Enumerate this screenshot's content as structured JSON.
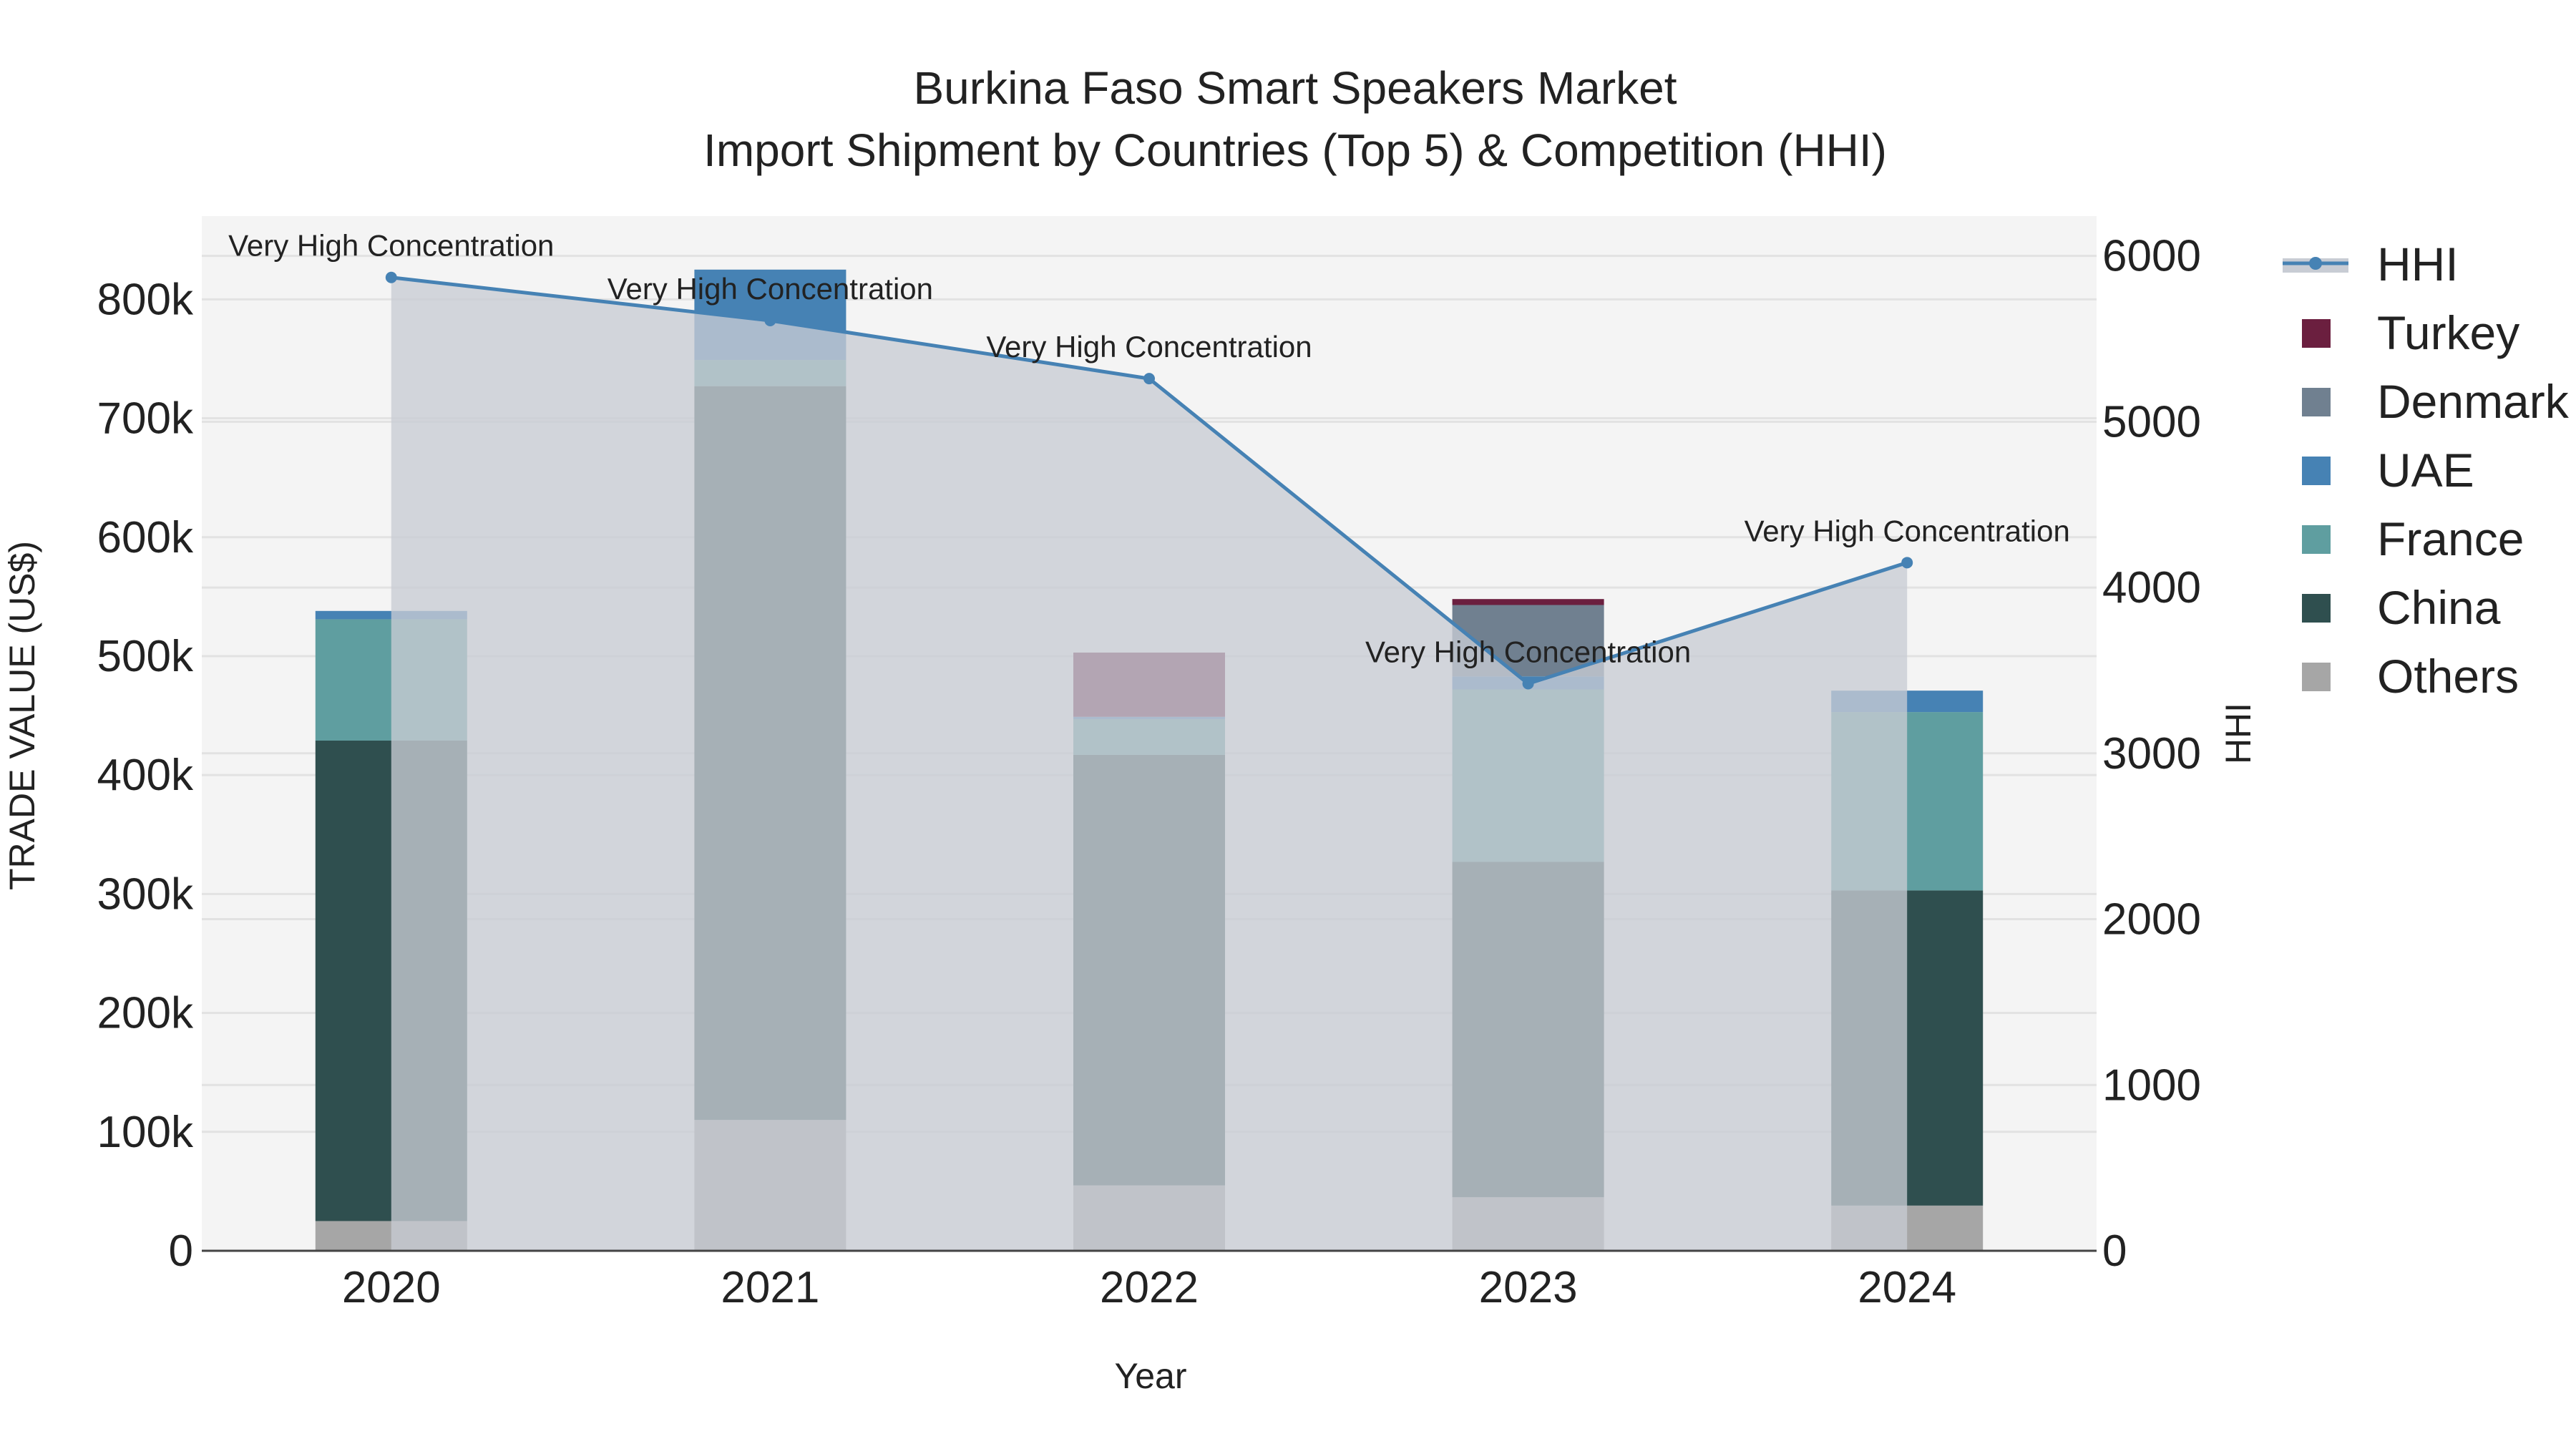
{
  "chart_data": {
    "type": "bar",
    "title_line1": "Burkina Faso Smart Speakers Market",
    "title_line2": "Import Shipment by Countries (Top 5) & Competition (HHI)",
    "xlabel": "Year",
    "ylabel": "TRADE VALUE (US$)",
    "y2label": "HHI",
    "categories": [
      "2020",
      "2021",
      "2022",
      "2023",
      "2024"
    ],
    "ylim": [
      0,
      870000
    ],
    "y2lim": [
      0,
      6240
    ],
    "yticks": [
      {
        "value": 0,
        "label": "0"
      },
      {
        "value": 100000,
        "label": "100k"
      },
      {
        "value": 200000,
        "label": "200k"
      },
      {
        "value": 300000,
        "label": "300k"
      },
      {
        "value": 400000,
        "label": "400k"
      },
      {
        "value": 500000,
        "label": "500k"
      },
      {
        "value": 600000,
        "label": "600k"
      },
      {
        "value": 700000,
        "label": "700k"
      },
      {
        "value": 800000,
        "label": "800k"
      }
    ],
    "y2ticks": [
      {
        "value": 0,
        "label": "0"
      },
      {
        "value": 1000,
        "label": "1000"
      },
      {
        "value": 2000,
        "label": "2000"
      },
      {
        "value": 3000,
        "label": "3000"
      },
      {
        "value": 4000,
        "label": "4000"
      },
      {
        "value": 5000,
        "label": "5000"
      },
      {
        "value": 6000,
        "label": "6000"
      }
    ],
    "grid": true,
    "legend_position": "right",
    "series": [
      {
        "name": "Others",
        "color": "#a6a6a6",
        "values": [
          25000,
          110000,
          55000,
          45000,
          38000
        ]
      },
      {
        "name": "China",
        "color": "#2f4f4f",
        "values": [
          404000,
          617000,
          362000,
          282000,
          265000
        ]
      },
      {
        "name": "France",
        "color": "#5f9ea0",
        "values": [
          102000,
          22000,
          30000,
          145000,
          150000
        ]
      },
      {
        "name": "UAE",
        "color": "#4682b4",
        "values": [
          7000,
          76000,
          2000,
          11000,
          18000
        ]
      },
      {
        "name": "Denmark",
        "color": "#708090",
        "values": [
          0,
          0,
          0,
          60000,
          0
        ]
      },
      {
        "name": "Turkey",
        "color": "#6b1f3f",
        "values": [
          0,
          0,
          54000,
          5000,
          0
        ]
      }
    ],
    "hhi": {
      "name": "HHI",
      "color": "#4682b4",
      "area_color": "#c8ccd4",
      "values": [
        5870,
        5610,
        5260,
        3420,
        4150
      ],
      "annotations": [
        "Very High Concentration",
        "Very High Concentration",
        "Very High Concentration",
        "Very High Concentration",
        "Very High Concentration"
      ]
    },
    "legend_order": [
      "HHI",
      "Turkey",
      "Denmark",
      "UAE",
      "France",
      "China",
      "Others"
    ]
  }
}
